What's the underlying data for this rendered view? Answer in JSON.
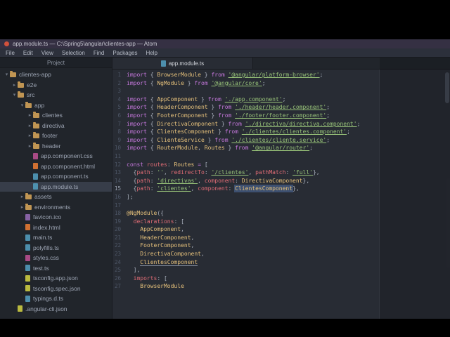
{
  "colors": {
    "accent_orange": "#d2513c",
    "titlebar_bg": "#353043",
    "menubar_bg": "#2c303b",
    "panel_bg": "#21252b",
    "editor_bg": "#282c34",
    "border": "#181a1f",
    "text_ui": "#9da5b4",
    "gutter": "#4d5666",
    "tab_text": "#d7dae0",
    "tk_kw": "#c678dd",
    "tk_cls": "#e5c07b",
    "tk_str": "#98c379",
    "tk_pun": "#abb2bf",
    "tk_var": "#e06c75",
    "sel_bg": "#3d5070",
    "folder_color": "#c09553",
    "ft_ts": "#519aba",
    "ft_html": "#e37933",
    "ft_css": "#b74f8f",
    "ft_json": "#cbcb41",
    "ft_ico": "#9068b0"
  },
  "title_bar": {
    "title": "app.module.ts — C:\\Spring5\\angular\\clientes-app — Atom"
  },
  "menu_bar": {
    "items": [
      "File",
      "Edit",
      "View",
      "Selection",
      "Find",
      "Packages",
      "Help"
    ]
  },
  "tree": {
    "header": "Project",
    "items": [
      {
        "label": "clientes-app",
        "kind": "folder",
        "depth": 0,
        "expanded": true
      },
      {
        "label": "e2e",
        "kind": "folder",
        "depth": 1,
        "expanded": false
      },
      {
        "label": "src",
        "kind": "folder",
        "depth": 1,
        "expanded": true
      },
      {
        "label": "app",
        "kind": "folder",
        "depth": 2,
        "expanded": true
      },
      {
        "label": "clientes",
        "kind": "folder",
        "depth": 3,
        "expanded": false
      },
      {
        "label": "directiva",
        "kind": "folder",
        "depth": 3,
        "expanded": false
      },
      {
        "label": "footer",
        "kind": "folder",
        "depth": 3,
        "expanded": false
      },
      {
        "label": "header",
        "kind": "folder",
        "depth": 3,
        "expanded": false
      },
      {
        "label": "app.component.css",
        "kind": "file",
        "ftype": "css",
        "depth": 3
      },
      {
        "label": "app.component.html",
        "kind": "file",
        "ftype": "html",
        "depth": 3
      },
      {
        "label": "app.component.ts",
        "kind": "file",
        "ftype": "ts",
        "depth": 3
      },
      {
        "label": "app.module.ts",
        "kind": "file",
        "ftype": "ts",
        "depth": 3,
        "selected": true
      },
      {
        "label": "assets",
        "kind": "folder",
        "depth": 2,
        "expanded": false
      },
      {
        "label": "environments",
        "kind": "folder",
        "depth": 2,
        "expanded": false
      },
      {
        "label": "favicon.ico",
        "kind": "file",
        "ftype": "ico",
        "depth": 2
      },
      {
        "label": "index.html",
        "kind": "file",
        "ftype": "html",
        "depth": 2
      },
      {
        "label": "main.ts",
        "kind": "file",
        "ftype": "ts",
        "depth": 2
      },
      {
        "label": "polyfills.ts",
        "kind": "file",
        "ftype": "ts",
        "depth": 2
      },
      {
        "label": "styles.css",
        "kind": "file",
        "ftype": "css",
        "depth": 2
      },
      {
        "label": "test.ts",
        "kind": "file",
        "ftype": "ts",
        "depth": 2
      },
      {
        "label": "tsconfig.app.json",
        "kind": "file",
        "ftype": "json",
        "depth": 2
      },
      {
        "label": "tsconfig.spec.json",
        "kind": "file",
        "ftype": "json",
        "depth": 2
      },
      {
        "label": "typings.d.ts",
        "kind": "file",
        "ftype": "ts",
        "depth": 2
      },
      {
        "label": ".angular-cli.json",
        "kind": "file",
        "ftype": "json",
        "depth": 1
      }
    ]
  },
  "editor": {
    "tab": {
      "label": "app.module.ts",
      "icon": "ts"
    },
    "lines": [
      {
        "n": 1,
        "tokens": [
          [
            "kw",
            "import"
          ],
          [
            "pun",
            " { "
          ],
          [
            "cls",
            "BrowserModule"
          ],
          [
            "pun",
            " } "
          ],
          [
            "kw",
            "from"
          ],
          [
            "pun",
            " "
          ],
          [
            "strU",
            "'@angular/platform-browser'"
          ],
          [
            "pun",
            ";"
          ]
        ]
      },
      {
        "n": 2,
        "tokens": [
          [
            "kw",
            "import"
          ],
          [
            "pun",
            " { "
          ],
          [
            "cls",
            "NgModule"
          ],
          [
            "pun",
            " } "
          ],
          [
            "kw",
            "from"
          ],
          [
            "pun",
            " "
          ],
          [
            "strU",
            "'@angular/core'"
          ],
          [
            "pun",
            ";"
          ]
        ]
      },
      {
        "n": 3,
        "tokens": []
      },
      {
        "n": 4,
        "tokens": [
          [
            "kw",
            "import"
          ],
          [
            "pun",
            " { "
          ],
          [
            "cls",
            "AppComponent"
          ],
          [
            "pun",
            " } "
          ],
          [
            "kw",
            "from"
          ],
          [
            "pun",
            " "
          ],
          [
            "strU",
            "'./app.component'"
          ],
          [
            "pun",
            ";"
          ]
        ]
      },
      {
        "n": 5,
        "tokens": [
          [
            "kw",
            "import"
          ],
          [
            "pun",
            " { "
          ],
          [
            "cls",
            "HeaderComponent"
          ],
          [
            "pun",
            " } "
          ],
          [
            "kw",
            "from"
          ],
          [
            "pun",
            " "
          ],
          [
            "strU",
            "'./header/header.component'"
          ],
          [
            "pun",
            ";"
          ]
        ]
      },
      {
        "n": 6,
        "tokens": [
          [
            "kw",
            "import"
          ],
          [
            "pun",
            " { "
          ],
          [
            "cls",
            "FooterComponent"
          ],
          [
            "pun",
            " } "
          ],
          [
            "kw",
            "from"
          ],
          [
            "pun",
            " "
          ],
          [
            "strU",
            "'./footer/footer.component'"
          ],
          [
            "pun",
            ";"
          ]
        ]
      },
      {
        "n": 7,
        "tokens": [
          [
            "kw",
            "import"
          ],
          [
            "pun",
            " { "
          ],
          [
            "cls",
            "DirectivaComponent"
          ],
          [
            "pun",
            " } "
          ],
          [
            "kw",
            "from"
          ],
          [
            "pun",
            " "
          ],
          [
            "strU",
            "'./directiva/directiva.component'"
          ],
          [
            "pun",
            ";"
          ]
        ]
      },
      {
        "n": 8,
        "tokens": [
          [
            "kw",
            "import"
          ],
          [
            "pun",
            " { "
          ],
          [
            "cls",
            "ClientesComponent"
          ],
          [
            "pun",
            " } "
          ],
          [
            "kw",
            "from"
          ],
          [
            "pun",
            " "
          ],
          [
            "strU",
            "'./clientes/clientes.component'"
          ],
          [
            "pun",
            ";"
          ]
        ]
      },
      {
        "n": 9,
        "tokens": [
          [
            "kw",
            "import"
          ],
          [
            "pun",
            " { "
          ],
          [
            "cls",
            "ClienteService"
          ],
          [
            "pun",
            " } "
          ],
          [
            "kw",
            "from"
          ],
          [
            "pun",
            " "
          ],
          [
            "strU",
            "'./clientes/cliente.service'"
          ],
          [
            "pun",
            ";"
          ]
        ]
      },
      {
        "n": 10,
        "tokens": [
          [
            "kw",
            "import"
          ],
          [
            "pun",
            " { "
          ],
          [
            "cls",
            "RouterModule"
          ],
          [
            "pun",
            ", "
          ],
          [
            "cls",
            "Routes"
          ],
          [
            "pun",
            " } "
          ],
          [
            "kw",
            "from"
          ],
          [
            "pun",
            " "
          ],
          [
            "strU",
            "'@angular/router'"
          ],
          [
            "pun",
            ";"
          ]
        ]
      },
      {
        "n": 11,
        "tokens": []
      },
      {
        "n": 12,
        "tokens": [
          [
            "kw",
            "const"
          ],
          [
            "pun",
            " "
          ],
          [
            "var",
            "routes"
          ],
          [
            "pun",
            ": "
          ],
          [
            "cls",
            "Routes"
          ],
          [
            "kw",
            " = "
          ],
          [
            "pun",
            "["
          ]
        ]
      },
      {
        "n": 13,
        "tokens": [
          [
            "pun",
            "  {"
          ],
          [
            "var",
            "path"
          ],
          [
            "pun",
            ": "
          ],
          [
            "str",
            "''"
          ],
          [
            "pun",
            ", "
          ],
          [
            "var",
            "redirectTo"
          ],
          [
            "pun",
            ": "
          ],
          [
            "strU",
            "'/clientes'"
          ],
          [
            "pun",
            ", "
          ],
          [
            "var",
            "pathMatch"
          ],
          [
            "pun",
            ": "
          ],
          [
            "strU",
            "'full'"
          ],
          [
            "pun",
            "},"
          ]
        ]
      },
      {
        "n": 14,
        "tokens": [
          [
            "pun",
            "  {"
          ],
          [
            "var",
            "path"
          ],
          [
            "pun",
            ": "
          ],
          [
            "strU",
            "'directivas'"
          ],
          [
            "pun",
            ", "
          ],
          [
            "var",
            "component"
          ],
          [
            "pun",
            ": "
          ],
          [
            "cls",
            "DirectivaComponent"
          ],
          [
            "pun",
            "},"
          ]
        ]
      },
      {
        "n": 15,
        "cursor": true,
        "tokens": [
          [
            "pun",
            "  {"
          ],
          [
            "var",
            "path"
          ],
          [
            "pun",
            ": "
          ],
          [
            "strU",
            "'clientes'"
          ],
          [
            "pun",
            ", "
          ],
          [
            "var",
            "component"
          ],
          [
            "pun",
            ": "
          ],
          [
            "sel",
            "ClientesComponent"
          ],
          [
            "pun",
            "},"
          ]
        ]
      },
      {
        "n": 16,
        "tokens": [
          [
            "pun",
            "];"
          ]
        ]
      },
      {
        "n": 17,
        "tokens": []
      },
      {
        "n": 18,
        "tokens": [
          [
            "cls",
            "@NgModule"
          ],
          [
            "pun",
            "({"
          ]
        ]
      },
      {
        "n": 19,
        "tokens": [
          [
            "pun",
            "  "
          ],
          [
            "var",
            "declarations"
          ],
          [
            "pun",
            ": ["
          ]
        ]
      },
      {
        "n": 20,
        "tokens": [
          [
            "pun",
            "    "
          ],
          [
            "cls",
            "AppComponent"
          ],
          [
            "pun",
            ","
          ]
        ]
      },
      {
        "n": 21,
        "tokens": [
          [
            "pun",
            "    "
          ],
          [
            "cls",
            "HeaderComponent"
          ],
          [
            "pun",
            ","
          ]
        ]
      },
      {
        "n": 22,
        "tokens": [
          [
            "pun",
            "    "
          ],
          [
            "cls",
            "FooterComponent"
          ],
          [
            "pun",
            ","
          ]
        ]
      },
      {
        "n": 23,
        "tokens": [
          [
            "pun",
            "    "
          ],
          [
            "cls",
            "DirectivaComponent"
          ],
          [
            "pun",
            ","
          ]
        ]
      },
      {
        "n": 24,
        "tokens": [
          [
            "pun",
            "    "
          ],
          [
            "occ",
            "ClientesComponent"
          ]
        ]
      },
      {
        "n": 25,
        "tokens": [
          [
            "pun",
            "  ],"
          ]
        ]
      },
      {
        "n": 26,
        "tokens": [
          [
            "pun",
            "  "
          ],
          [
            "var",
            "imports"
          ],
          [
            "pun",
            ": ["
          ]
        ]
      },
      {
        "n": 27,
        "tokens": [
          [
            "pun",
            "    "
          ],
          [
            "cls",
            "BrowserModule"
          ]
        ]
      }
    ]
  }
}
